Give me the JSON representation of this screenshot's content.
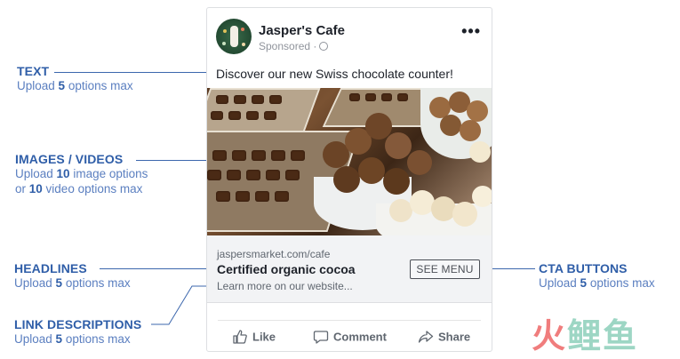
{
  "annotations": {
    "text": {
      "title": "TEXT",
      "pre": "Upload ",
      "num": "5",
      "post": " options max"
    },
    "images": {
      "title": "IMAGES / VIDEOS",
      "l1_pre": "Upload ",
      "l1_num": "10",
      "l1_post": " image options",
      "l2_pre": "or ",
      "l2_num": "10",
      "l2_post": " video options max"
    },
    "headlines": {
      "title": "HEADLINES",
      "pre": "Upload ",
      "num": "5",
      "post": " options max"
    },
    "link_descriptions": {
      "title": "LINK DESCRIPTIONS",
      "pre": "Upload ",
      "num": "5",
      "post": " options max"
    },
    "cta_buttons": {
      "title": "CTA BUTTONS",
      "pre": "Upload ",
      "num": "5",
      "post": " options max"
    }
  },
  "ad": {
    "page_name": "Jasper's Cafe",
    "sponsored": "Sponsored",
    "separator": "·",
    "more_icon": "more-horizontal-icon",
    "text": "Discover our new Swiss chocolate counter!",
    "domain": "jaspersmarket.com/cafe",
    "headline": "Certified organic cocoa",
    "description": "Learn more on our website...",
    "cta": "SEE MENU",
    "actions": [
      {
        "label": "Like",
        "icon": "thumbs-up-icon"
      },
      {
        "label": "Comment",
        "icon": "comment-icon"
      },
      {
        "label": "Share",
        "icon": "share-icon"
      }
    ]
  },
  "watermark": {
    "left": "火",
    "right": "鲤鱼"
  },
  "colors": {
    "annotation_title": "#2f5ea8",
    "annotation_sub": "#5b7fc0",
    "link_area_bg": "#f2f3f5",
    "watermark_red": "#f07d7d",
    "watermark_teal": "#9dd6c4"
  }
}
